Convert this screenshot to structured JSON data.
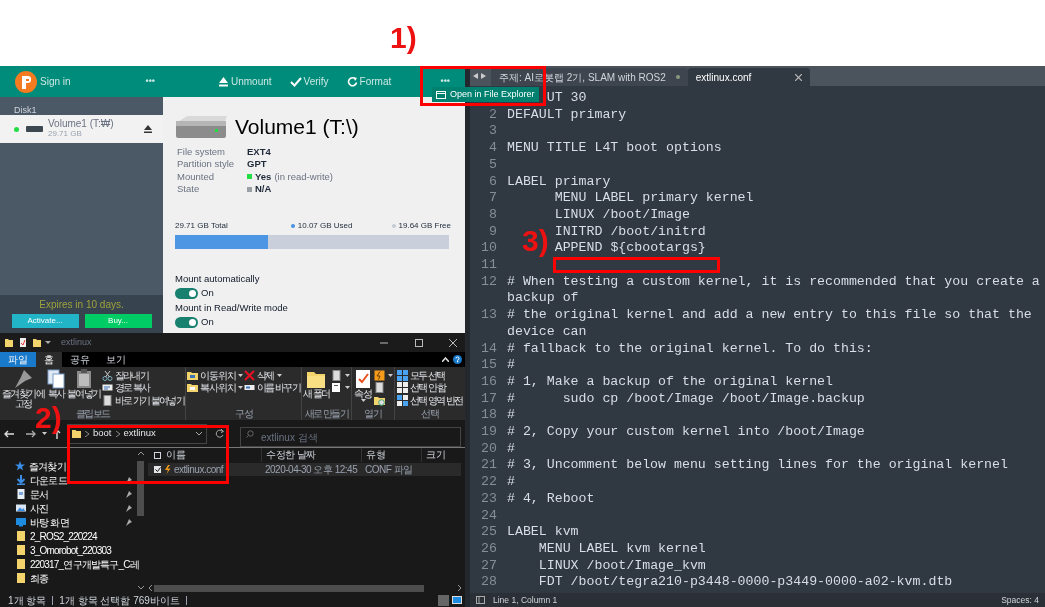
{
  "annotations": [
    {
      "label": "1)"
    },
    {
      "label": "2)"
    },
    {
      "label": "3)"
    }
  ],
  "drive_app": {
    "header": {
      "sign_in": "Sign in",
      "menu_left": "•••",
      "actions": [
        {
          "kind": "unmount",
          "label": "Unmount"
        },
        {
          "kind": "verify",
          "label": "Verify"
        },
        {
          "kind": "format",
          "label": "Format"
        }
      ],
      "menu_right": "•••"
    },
    "dropdown": {
      "items": [
        {
          "label": "Open in File Explorer"
        }
      ]
    },
    "sidebar": {
      "disk": "Disk1",
      "volumes": [
        {
          "name": "Volume1 (T:₩)",
          "size": "29.71 GB",
          "selected": true
        }
      ],
      "expiry": "Expires in 10 days.",
      "buttons": [
        {
          "kind": "activate",
          "label": "Activate..."
        },
        {
          "kind": "buy",
          "label": "Buy..."
        }
      ]
    },
    "details": {
      "title": "Volume1 (T:\\)",
      "properties": [
        {
          "name": "File system",
          "value": "EXT4"
        },
        {
          "name": "Partition style",
          "value": "GPT"
        },
        {
          "name": "Mounted",
          "value": "Yes",
          "note": "(in read-write)",
          "color": "#22dd44"
        },
        {
          "name": "State",
          "value": "N/A",
          "color": "#9aa0a6"
        }
      ],
      "usage": {
        "total": "29.71 GB Total",
        "used": "10.07 GB Used",
        "free": "19.64 GB Free",
        "level": 0.339
      },
      "toggles": [
        {
          "label": "Mount automatically",
          "on": true,
          "state": "On"
        },
        {
          "label": "Mount in Read/Write mode",
          "on": true,
          "state": "On"
        }
      ]
    }
  },
  "file_explorer": {
    "title": "extlinux",
    "ribbon_tabs": [
      {
        "label": "파일",
        "kind": "menu",
        "selected": false
      },
      {
        "label": "홈",
        "kind": "tab",
        "selected": true
      },
      {
        "label": "공유",
        "kind": "tab",
        "selected": false
      },
      {
        "label": "보기",
        "kind": "tab",
        "selected": false
      }
    ],
    "ribbon_groups": [
      {
        "label": "클립보드",
        "columns": [
          {
            "items": [
              {
                "kind": "pin",
                "label": "즐겨찾기에 고정"
              }
            ]
          },
          {
            "items": [
              {
                "kind": "copy",
                "label": "복사"
              }
            ]
          },
          {
            "items": [
              {
                "kind": "paste",
                "label": "붙여넣기"
              }
            ]
          },
          {
            "items": [
              {
                "kind": "cut",
                "label": "잘라내기"
              },
              {
                "kind": "path",
                "label": "경로 복사"
              },
              {
                "kind": "shortcut",
                "label": "바로 가기 붙여넣기"
              }
            ]
          }
        ]
      },
      {
        "label": "구성",
        "columns": [
          {
            "items": [
              {
                "kind": "move",
                "label": "이동 위치",
                "dropdown": true
              },
              {
                "kind": "copyto",
                "label": "복사 위치",
                "dropdown": true
              }
            ]
          },
          {
            "items": [
              {
                "kind": "delete",
                "label": "삭제",
                "dropdown": true
              },
              {
                "kind": "rename",
                "label": "이름 바꾸기"
              }
            ]
          }
        ]
      },
      {
        "label": "새로 만들기",
        "columns": [
          {
            "items": [
              {
                "kind": "newfolder",
                "label": "새 폴더"
              }
            ]
          },
          {
            "items": [
              {
                "kind": "newitem",
                "dropdown": true
              },
              {
                "kind": "easy",
                "dropdown": true
              }
            ]
          }
        ]
      },
      {
        "label": "열기",
        "columns": [
          {
            "items": [
              {
                "kind": "properties",
                "label": "속성",
                "dropdown": true
              }
            ]
          },
          {
            "items": [
              {
                "kind": "open",
                "dropdown": true
              },
              {
                "kind": "edit"
              },
              {
                "kind": "history"
              }
            ]
          }
        ]
      },
      {
        "label": "선택",
        "columns": [
          {
            "items": [
              {
                "kind": "selectall",
                "label": "모두 선택"
              },
              {
                "kind": "selectnone",
                "label": "선택 안 함"
              },
              {
                "kind": "invert",
                "label": "선택 영역 반전"
              }
            ]
          }
        ]
      }
    ],
    "path": [
      "boot",
      "extlinux"
    ],
    "search": {
      "placeholder": "extlinux 검색"
    },
    "nav": [
      {
        "kind": "star",
        "label": "즐겨찾기",
        "pinned": false
      },
      {
        "kind": "download",
        "label": "다운로드",
        "pinned": true
      },
      {
        "kind": "docs",
        "label": "문서",
        "pinned": true
      },
      {
        "kind": "pictures",
        "label": "사진",
        "pinned": true
      },
      {
        "kind": "desktop",
        "label": "바탕 화면",
        "pinned": true
      },
      {
        "kind": "folder",
        "label": "2_ROS2_220224",
        "pinned": false
      },
      {
        "kind": "folder",
        "label": "3_Omorobot_220303",
        "pinned": false
      },
      {
        "kind": "folder",
        "label": "220317_연구개발특구_C레",
        "pinned": false
      },
      {
        "kind": "folder",
        "label": "최종",
        "pinned": false
      }
    ],
    "header_checkbox": {
      "checked": false
    },
    "columns": [
      "이름",
      "수정한 날짜",
      "유형",
      "크기"
    ],
    "rows": [
      {
        "name": "extlinux.conf",
        "modified": "2020-04-30 오후 12:45",
        "type": "CONF 파일",
        "selected": true,
        "checked": true
      }
    ],
    "status": [
      "1개 항목",
      "1개 항목 선택함 769바이트"
    ]
  },
  "editor": {
    "tabs": [
      {
        "label": "주제: AI로봇랩 2기, SLAM with ROS2",
        "selected": false,
        "modified": true
      },
      {
        "label": "extlinux.conf",
        "selected": true,
        "modified": false
      }
    ],
    "lines": [
      {
        "text": "UT 30"
      },
      {
        "number": "2",
        "text": "DEFAULT primary"
      },
      {
        "number": "3"
      },
      {
        "number": "4",
        "text": "MENU TITLE L4T boot options"
      },
      {
        "number": "5"
      },
      {
        "number": "6",
        "text": "LABEL primary"
      },
      {
        "number": "7",
        "text": "      MENU LABEL primary kernel"
      },
      {
        "number": "8",
        "text": "      LINUX /boot/Image"
      },
      {
        "number": "9",
        "text": "      INITRD /boot/initrd"
      },
      {
        "number": "10",
        "text": "      APPEND ${cbootargs}"
      },
      {
        "number": "11"
      },
      {
        "number": "12",
        "text": "# When testing a custom kernel, it is recommended that you create a backup of"
      },
      {
        "number": "13",
        "text": "# the original kernel and add a new entry to this file so that the device can"
      },
      {
        "number": "14",
        "text": "# fallback to the original kernel. To do this:"
      },
      {
        "number": "15",
        "text": "#"
      },
      {
        "number": "16",
        "text": "# 1, Make a backup of the original kernel"
      },
      {
        "number": "17",
        "text": "#      sudo cp /boot/Image /boot/Image.backup"
      },
      {
        "number": "18",
        "text": "#"
      },
      {
        "number": "19",
        "text": "# 2, Copy your custom kernel into /boot/Image"
      },
      {
        "number": "20",
        "text": "#"
      },
      {
        "number": "21",
        "text": "# 3, Uncomment below menu setting lines for the original kernel"
      },
      {
        "number": "22",
        "text": "#"
      },
      {
        "number": "23",
        "text": "# 4, Reboot"
      },
      {
        "number": "24"
      },
      {
        "number": "25",
        "text": "LABEL kvm"
      },
      {
        "number": "26",
        "text": "    MENU LABEL kvm kernel"
      },
      {
        "number": "27",
        "text": "    LINUX /boot/Image_kvm"
      },
      {
        "number": "28",
        "text": "    FDT /boot/tegra210-p3448-0000-p3449-0000-a02-kvm.dtb"
      }
    ],
    "status": {
      "position": "Line 1, Column 1",
      "indent": "Spaces: 4"
    }
  }
}
